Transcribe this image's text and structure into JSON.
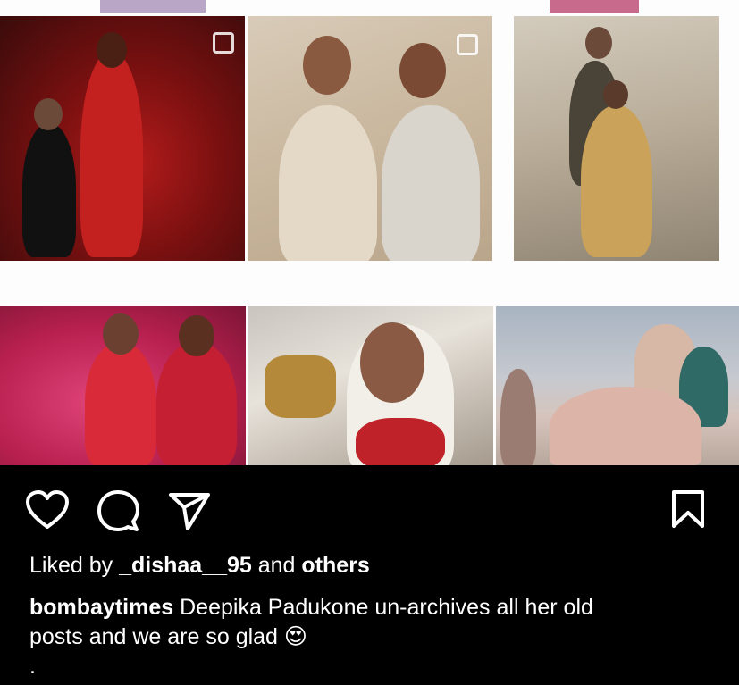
{
  "likes": {
    "prefix": "Liked by",
    "user": "_dishaa__95",
    "joiner": "and",
    "others": "others"
  },
  "caption": {
    "username": "bombaytimes",
    "line1": "Deepika Padukone un-archives all her old",
    "line2": "posts and we are so glad",
    "emoji": "😍",
    "trailing": "."
  },
  "icons": [
    "heart-icon",
    "comment-icon",
    "share-icon",
    "bookmark-icon"
  ],
  "colors": {
    "background": "#000000",
    "text": "#ffffff"
  }
}
